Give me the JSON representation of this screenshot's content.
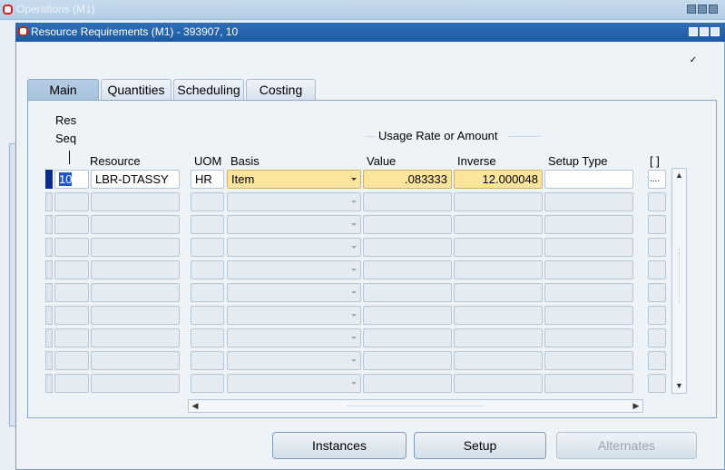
{
  "background_window": {
    "title": "Operations (M1)"
  },
  "window": {
    "title": "Resource Requirements (M1) - 393907, 10"
  },
  "checkbox": {
    "glyph": "✓",
    "checked": true
  },
  "tabs": [
    {
      "label": "Main",
      "active": true
    },
    {
      "label": "Quantities",
      "active": false
    },
    {
      "label": "Scheduling",
      "active": false
    },
    {
      "label": "Costing",
      "active": false
    }
  ],
  "grid": {
    "group_header": "Usage Rate or Amount",
    "headers": {
      "res_seq_line1": "Res",
      "res_seq_line2": "Seq",
      "resource": "Resource",
      "uom": "UOM",
      "basis": "Basis",
      "value": "Value",
      "inverse": "Inverse",
      "setup_type": "Setup Type",
      "flex": "[ ]"
    },
    "rows": [
      {
        "seq": "10",
        "resource": "LBR-DTASSY",
        "uom": "HR",
        "basis": "Item",
        "value": ".083333",
        "inverse": "12.000048",
        "setup_type": "",
        "flex": "...."
      },
      {
        "seq": "",
        "resource": "",
        "uom": "",
        "basis": "",
        "value": "",
        "inverse": "",
        "setup_type": "",
        "flex": ""
      },
      {
        "seq": "",
        "resource": "",
        "uom": "",
        "basis": "",
        "value": "",
        "inverse": "",
        "setup_type": "",
        "flex": ""
      },
      {
        "seq": "",
        "resource": "",
        "uom": "",
        "basis": "",
        "value": "",
        "inverse": "",
        "setup_type": "",
        "flex": ""
      },
      {
        "seq": "",
        "resource": "",
        "uom": "",
        "basis": "",
        "value": "",
        "inverse": "",
        "setup_type": "",
        "flex": ""
      },
      {
        "seq": "",
        "resource": "",
        "uom": "",
        "basis": "",
        "value": "",
        "inverse": "",
        "setup_type": "",
        "flex": ""
      },
      {
        "seq": "",
        "resource": "",
        "uom": "",
        "basis": "",
        "value": "",
        "inverse": "",
        "setup_type": "",
        "flex": ""
      },
      {
        "seq": "",
        "resource": "",
        "uom": "",
        "basis": "",
        "value": "",
        "inverse": "",
        "setup_type": "",
        "flex": ""
      },
      {
        "seq": "",
        "resource": "",
        "uom": "",
        "basis": "",
        "value": "",
        "inverse": "",
        "setup_type": "",
        "flex": ""
      },
      {
        "seq": "",
        "resource": "",
        "uom": "",
        "basis": "",
        "value": "",
        "inverse": "",
        "setup_type": "",
        "flex": ""
      }
    ]
  },
  "buttons": {
    "instances": "Instances",
    "setup": "Setup",
    "alternates": "Alternates"
  },
  "colors": {
    "title_bar": "#1d5aa5",
    "required_field": "#fbe59b",
    "current_record": "#0d2a88"
  }
}
